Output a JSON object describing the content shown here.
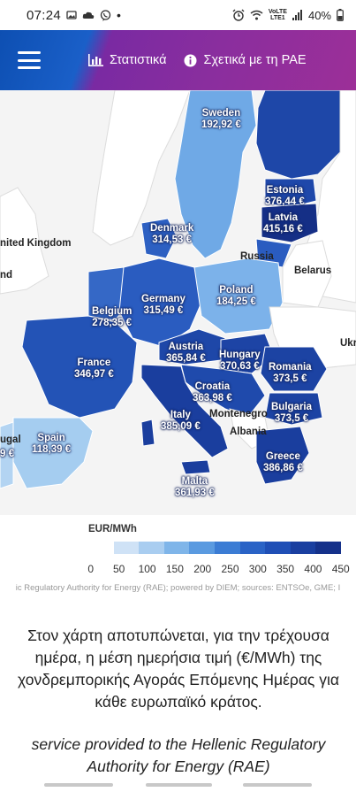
{
  "status_bar": {
    "time": "07:24",
    "battery": "40%",
    "network_label": "LTE1",
    "left_icons": [
      "photos-icon",
      "cloud-icon",
      "viber-icon",
      "dot-icon"
    ],
    "right_icons": [
      "alarm-icon",
      "wifi-icon",
      "volte-icon",
      "signal-icon",
      "battery-icon"
    ]
  },
  "navbar": {
    "stats_label": "Στατιστικά",
    "about_label": "Σχετικά με τη ΡΑΕ"
  },
  "map": {
    "countries": [
      {
        "name": "Sweden",
        "price": "192,92 €"
      },
      {
        "name": "Estonia",
        "price": "376,44 €"
      },
      {
        "name": "Latvia",
        "price": "415,16 €"
      },
      {
        "name": "Denmark",
        "price": "314,53 €"
      },
      {
        "name": "Germany",
        "price": "315,49 €"
      },
      {
        "name": "Belgium",
        "price": "278,35 €"
      },
      {
        "name": "Poland",
        "price": "184,25 €"
      },
      {
        "name": "France",
        "price": "346,97 €"
      },
      {
        "name": "Austria",
        "price": "365,84 €"
      },
      {
        "name": "Hungary",
        "price": "370,63 €"
      },
      {
        "name": "Romania",
        "price": "373,5 €"
      },
      {
        "name": "Croatia",
        "price": "363,98 €"
      },
      {
        "name": "Bulgaria",
        "price": "373,5 €"
      },
      {
        "name": "Italy",
        "price": "385,09 €"
      },
      {
        "name": "Spain",
        "price": "118,39 €"
      },
      {
        "name": "Greece",
        "price": "386,86 €"
      },
      {
        "name": "Malta",
        "price": "361,93 €"
      }
    ],
    "plain_labels": [
      "nited Kingdom",
      "Russia",
      "Belarus",
      "Ukra",
      "Montenegro",
      "Albania",
      "ugal",
      "9 €",
      "nd"
    ]
  },
  "legend": {
    "title": "EUR/MWh",
    "ticks": [
      "0",
      "50",
      "100",
      "150",
      "200",
      "250",
      "300",
      "350",
      "400",
      "450"
    ],
    "colors": [
      "#ffffff",
      "#cfe2f6",
      "#a9cdf0",
      "#7fb5e9",
      "#5a9ae0",
      "#3b7cd4",
      "#2a63c6",
      "#1f4fb6",
      "#1a3fa0",
      "#15318a"
    ]
  },
  "credit": "ic Regulatory Authority for Energy (RAE); powered by DIEM; sources: ENTSOe, GME; I",
  "description": "Στον χάρτη αποτυπώνεται, για την τρέχουσα ημέρα, η μέση ημερήσια τιμή (€/MWh) της χονδρεμπορικής Αγοράς Επόμενης Ημέρας για κάθε ευρωπαϊκό κράτος.",
  "service": "service provided to the Hellenic Regulatory Authority for Energy (RAE)"
}
